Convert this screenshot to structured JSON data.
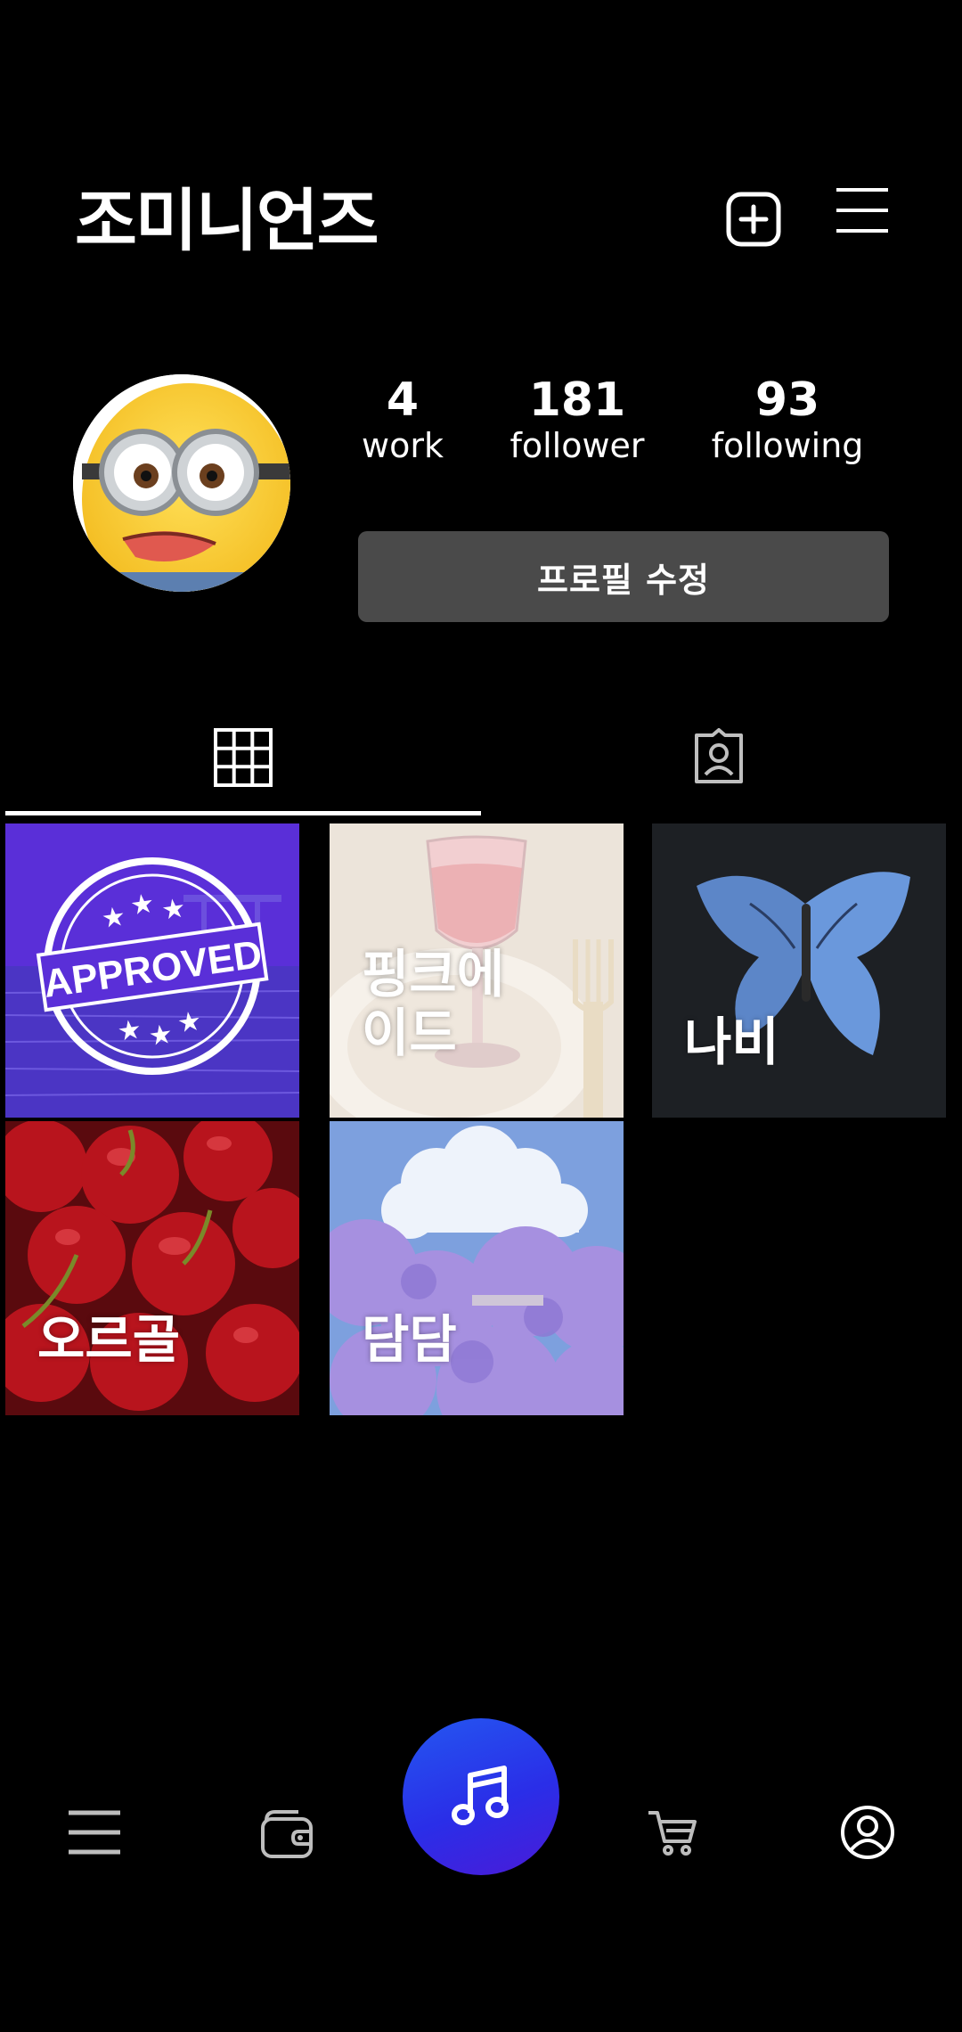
{
  "header": {
    "title": "조미니언즈",
    "add_icon": "plus-square-icon",
    "menu_icon": "hamburger-icon"
  },
  "profile": {
    "stats": [
      {
        "value": "4",
        "label": "work"
      },
      {
        "value": "181",
        "label": "follower"
      },
      {
        "value": "93",
        "label": "following"
      }
    ],
    "edit_button_label": "프로필 수정"
  },
  "tabs": [
    {
      "icon": "grid-icon",
      "active": true
    },
    {
      "icon": "tagged-user-icon",
      "active": false
    }
  ],
  "works": [
    {
      "title": "",
      "image": "approved-stamp"
    },
    {
      "title": "핑크에\n이드",
      "image": "pink-drink"
    },
    {
      "title": "나비",
      "image": "blue-butterfly"
    },
    {
      "title": "오르골",
      "image": "cherries"
    },
    {
      "title": "담담",
      "image": "jacaranda-sky"
    }
  ],
  "approved_stamp": {
    "text": "APPROVED"
  },
  "bottom_nav": [
    {
      "icon": "list-icon"
    },
    {
      "icon": "wallet-icon"
    },
    {
      "icon": "music-note-icon"
    },
    {
      "icon": "cart-icon"
    },
    {
      "icon": "user-circle-icon"
    }
  ],
  "colors": {
    "background": "#000000",
    "button": "#4a4a4a",
    "fab": "#2a3af0"
  }
}
